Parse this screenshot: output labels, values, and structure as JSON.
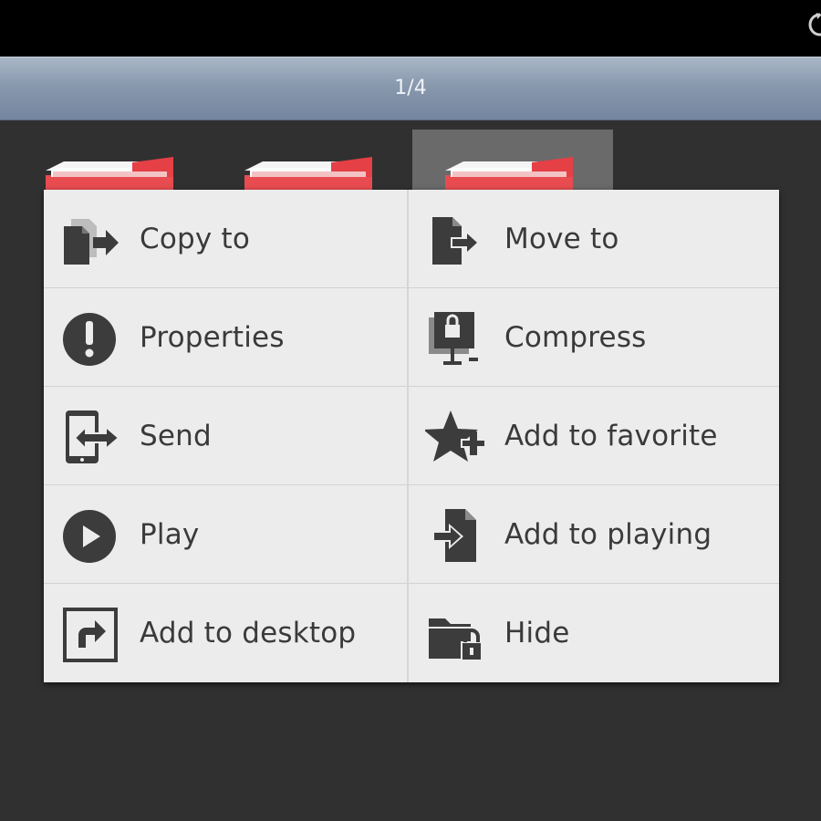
{
  "pager": {
    "text": "1/4"
  },
  "folders": [
    {
      "icon": "folder-icon",
      "selected": false
    },
    {
      "icon": "folder-icon",
      "selected": false
    },
    {
      "icon": "folder-icon",
      "selected": true
    }
  ],
  "menu": {
    "items": [
      {
        "label": "Copy to",
        "icon": "copy-to-icon"
      },
      {
        "label": "Move to",
        "icon": "move-to-icon"
      },
      {
        "label": "Properties",
        "icon": "properties-icon"
      },
      {
        "label": "Compress",
        "icon": "compress-icon"
      },
      {
        "label": "Send",
        "icon": "send-icon"
      },
      {
        "label": "Add to favorite",
        "icon": "add-favorite-icon"
      },
      {
        "label": "Play",
        "icon": "play-icon"
      },
      {
        "label": "Add to playing",
        "icon": "add-to-playing-icon"
      },
      {
        "label": "Add to desktop",
        "icon": "add-to-desktop-icon"
      },
      {
        "label": "Hide",
        "icon": "hide-icon"
      }
    ]
  },
  "colors": {
    "background": "#2f2f2f",
    "menu_background": "#ececec",
    "icon_dark": "#3c3c3c",
    "folder_red": "#e84c50"
  }
}
